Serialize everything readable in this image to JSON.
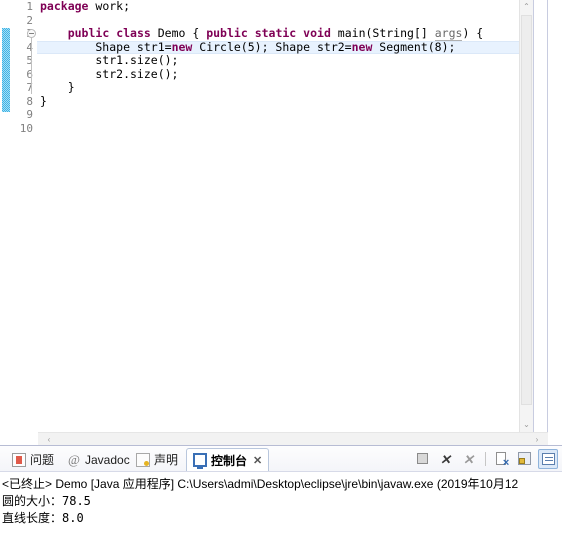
{
  "editor": {
    "line_numbers": [
      "1",
      "2",
      "3",
      "4",
      "5",
      "6",
      "7",
      "8",
      "9",
      "10"
    ],
    "current_line": 4,
    "lines": [
      {
        "n": 1,
        "tokens": [
          {
            "t": "package",
            "c": "kw"
          },
          {
            "t": " work;",
            "c": "pln"
          }
        ]
      },
      {
        "n": 2,
        "tokens": []
      },
      {
        "n": 3,
        "tokens": [
          {
            "t": "    ",
            "c": "pln"
          },
          {
            "t": "public",
            "c": "kw"
          },
          {
            "t": " ",
            "c": "pln"
          },
          {
            "t": "class",
            "c": "kw"
          },
          {
            "t": " Demo { ",
            "c": "pln"
          },
          {
            "t": "public",
            "c": "kw"
          },
          {
            "t": " ",
            "c": "pln"
          },
          {
            "t": "static",
            "c": "kw"
          },
          {
            "t": " ",
            "c": "pln"
          },
          {
            "t": "void",
            "c": "kw"
          },
          {
            "t": " main(String[] ",
            "c": "pln"
          },
          {
            "t": "args",
            "c": "param"
          },
          {
            "t": ") {",
            "c": "pln"
          }
        ]
      },
      {
        "n": 4,
        "tokens": [
          {
            "t": "        Shape str1=",
            "c": "pln"
          },
          {
            "t": "new",
            "c": "kw"
          },
          {
            "t": " Circle(5); Shape str2=",
            "c": "pln"
          },
          {
            "t": "new",
            "c": "kw"
          },
          {
            "t": " Segment(8);",
            "c": "pln"
          }
        ]
      },
      {
        "n": 5,
        "tokens": [
          {
            "t": "        str1.size();",
            "c": "pln"
          }
        ]
      },
      {
        "n": 6,
        "tokens": [
          {
            "t": "        str2.size();",
            "c": "pln"
          }
        ]
      },
      {
        "n": 7,
        "tokens": [
          {
            "t": "    }",
            "c": "pln"
          }
        ]
      },
      {
        "n": 8,
        "tokens": [
          {
            "t": "}",
            "c": "pln"
          }
        ]
      },
      {
        "n": 9,
        "tokens": []
      },
      {
        "n": 10,
        "tokens": []
      }
    ],
    "fold_marker_line": 3,
    "scrollbar": {
      "up_arrow": "⌃",
      "down_arrow": "⌄",
      "left_arrow": "‹",
      "right_arrow": "›"
    }
  },
  "bottom_panel": {
    "tabs": [
      {
        "label": "问题",
        "icon": "problems-icon",
        "active": false
      },
      {
        "label": "Javadoc",
        "icon": "javadoc-icon",
        "active": false
      },
      {
        "label": "声明",
        "icon": "declaration-icon",
        "active": false
      },
      {
        "label": "控制台",
        "icon": "console-icon",
        "active": true
      }
    ],
    "close_glyph": "✕",
    "toolbar": [
      {
        "name": "terminate-button",
        "title": "终止"
      },
      {
        "name": "remove-launch-button",
        "title": "移除启动"
      },
      {
        "name": "remove-all-terminated-button",
        "title": "全部移除"
      },
      {
        "name": "clear-console-button",
        "title": "清除控制台"
      },
      {
        "name": "scroll-lock-button",
        "title": "滚动锁定"
      },
      {
        "name": "pin-console-button",
        "title": "固定控制台"
      }
    ],
    "console": {
      "header": "<已终止> Demo [Java 应用程序] C:\\Users\\admi\\Desktop\\eclipse\\jre\\bin\\javaw.exe  (2019年10月12",
      "output": [
        "圆的大小：78.5",
        "直线长度：8.0"
      ]
    }
  },
  "colors": {
    "keyword": "#7f0055",
    "current_line": "#e8f2fe",
    "change_bar": "#3cb4e6",
    "panel_border": "#b7bcd4"
  }
}
